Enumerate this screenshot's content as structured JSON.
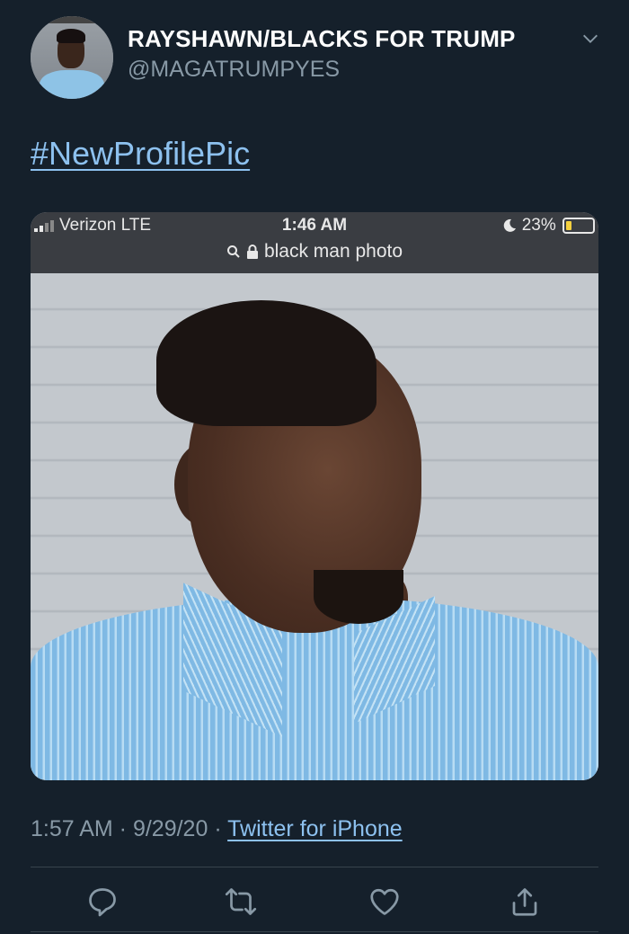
{
  "author": {
    "display_name": "RAYSHAWN/BLACKS FOR TRUMP",
    "handle": "@MAGATRUMPYES"
  },
  "tweet": {
    "text": "#NewProfilePic",
    "timestamp_time": "1:57 AM",
    "separator": " · ",
    "timestamp_date": "9/29/20",
    "source": "Twitter for iPhone"
  },
  "screenshot_status_bar": {
    "carrier": "Verizon  LTE",
    "time": "1:46 AM",
    "battery": "23%",
    "battery_level": 0.23,
    "url": "black man photo"
  },
  "actions": [
    "reply-icon",
    "retweet-icon",
    "like-icon",
    "share-icon"
  ],
  "colors": {
    "background": "#15202b",
    "link": "#8dc1ef",
    "secondary_text": "#8899a6",
    "divider": "#38444d"
  }
}
